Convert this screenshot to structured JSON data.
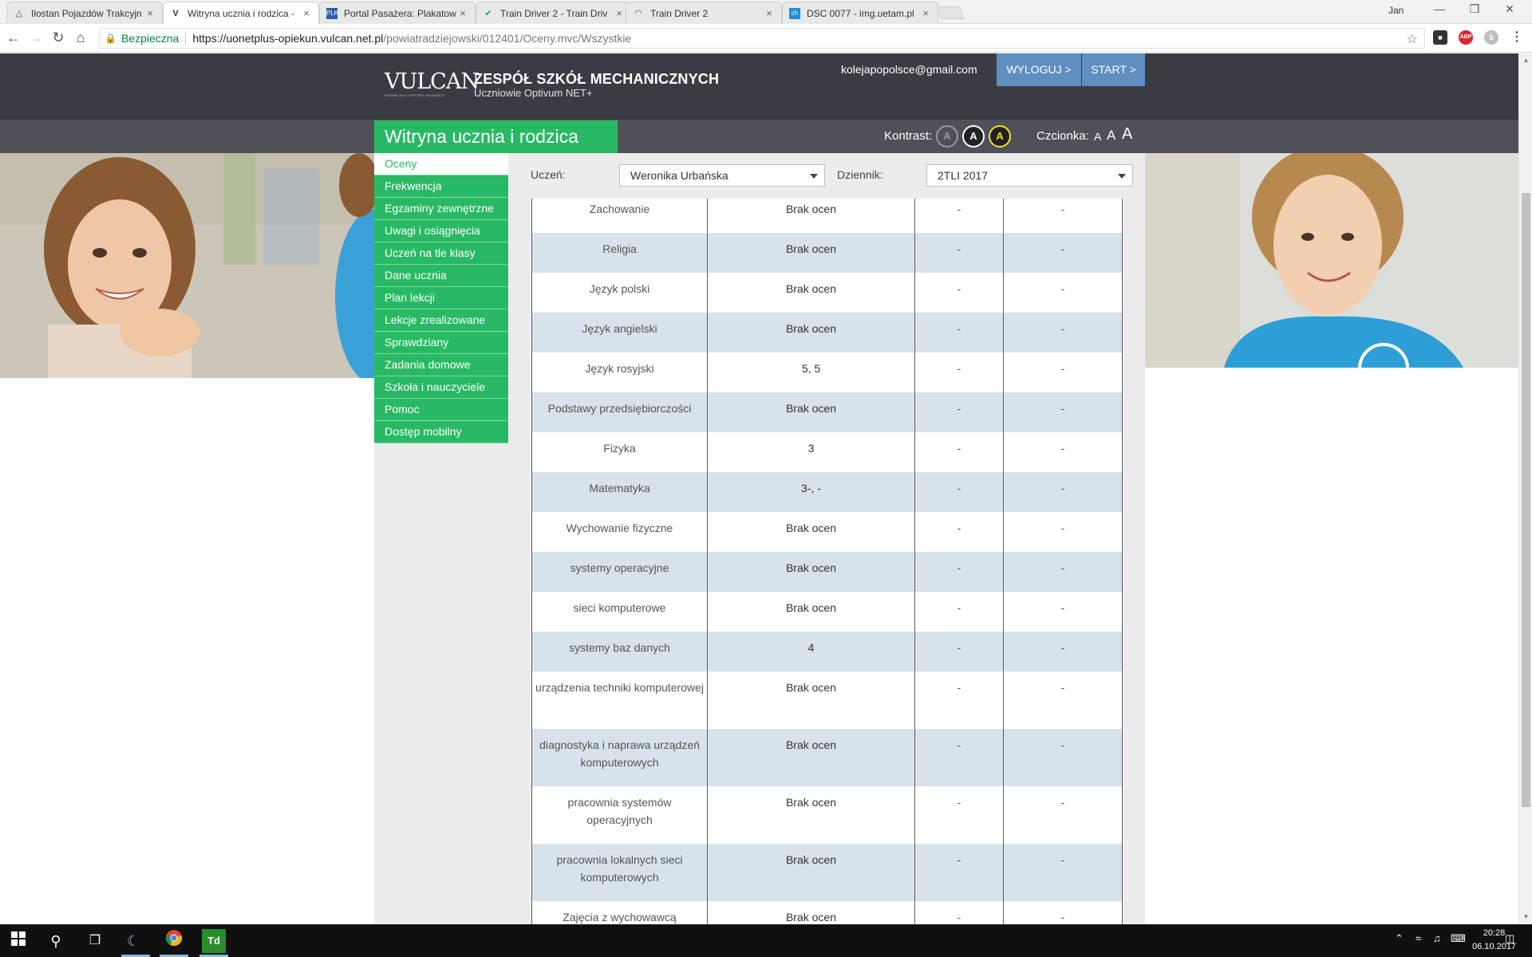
{
  "browser": {
    "tabs": [
      {
        "title": "Ilostan Pojazdów Trakcyjn",
        "icon": "page-icon"
      },
      {
        "title": "Witryna ucznia i rodzica -",
        "icon": "vulcan-icon"
      },
      {
        "title": "Portal Pasażera: Plakatow",
        "icon": "plk-icon"
      },
      {
        "title": "Train Driver 2 - Train Driv",
        "icon": "check-icon"
      },
      {
        "title": "Train Driver 2",
        "icon": "loading-icon"
      },
      {
        "title": "DSC 0077 - img.uetam.pl",
        "icon": "uetam-icon"
      }
    ],
    "profile": "Jan",
    "secure_label": "Bezpieczna",
    "url_host": "https://uonetplus-opiekun.vulcan.net.pl",
    "url_path": "/powiatradziejowski/012401/Oceny.mvc/Wszystkie"
  },
  "header": {
    "logo_text": "VULCAN",
    "logo_tagline": "RAZEM DLA LEPSZEJ EDUKACJI",
    "school_name": "ZESPÓŁ SZKÓŁ MECHANICZNYCH",
    "school_sub": "Uczniowie Optivum NET+",
    "email": "kolejapopolsce@gmail.com",
    "logout": "WYLOGUJ >",
    "start": "START >",
    "site_title": "Witryna ucznia i rodzica",
    "kontrast_label": "Kontrast:",
    "kontrast_buttons": [
      "A",
      "A",
      "A"
    ],
    "czcionka_label": "Czcionka:",
    "font_buttons": [
      "A",
      "A",
      "A"
    ]
  },
  "menu": [
    "Oceny",
    "Frekwencja",
    "Egzaminy zewnętrzne",
    "Uwagi i osiągnięcia",
    "Uczeń na tle klasy",
    "Dane ucznia",
    "Plan lekcji",
    "Lekcje zrealizowane",
    "Sprawdziany",
    "Zadania domowe",
    "Szkoła i nauczyciele",
    "Pomoc",
    "Dostęp mobilny"
  ],
  "filters": {
    "student_label": "Uczeń:",
    "student_value": "Weronika Urbańska",
    "journal_label": "Dziennik:",
    "journal_value": "2TLI 2017"
  },
  "grades": [
    {
      "subject": "Zachowanie",
      "grades": "Brak ocen",
      "avg": "-",
      "final": "-"
    },
    {
      "subject": "Religia",
      "grades": "Brak ocen",
      "avg": "-",
      "final": "-"
    },
    {
      "subject": "Język polski",
      "grades": "Brak ocen",
      "avg": "-",
      "final": "-"
    },
    {
      "subject": "Język angielski",
      "grades": "Brak ocen",
      "avg": "-",
      "final": "-"
    },
    {
      "subject": "Język rosyjski",
      "grades": "5, 5",
      "avg": "-",
      "final": "-"
    },
    {
      "subject": "Podstawy przedsiębiorczości",
      "grades": "Brak ocen",
      "avg": "-",
      "final": "-"
    },
    {
      "subject": "Fizyka",
      "grades": "3",
      "avg": "-",
      "final": "-"
    },
    {
      "subject": "Matematyka",
      "grades": "3-, -",
      "avg": "-",
      "final": "-"
    },
    {
      "subject": "Wychowanie fizyczne",
      "grades": "Brak ocen",
      "avg": "-",
      "final": "-"
    },
    {
      "subject": "systemy operacyjne",
      "grades": "Brak ocen",
      "avg": "-",
      "final": "-"
    },
    {
      "subject": "sieci komputerowe",
      "grades": "Brak ocen",
      "avg": "-",
      "final": "-"
    },
    {
      "subject": "systemy baz danych",
      "grades": "4",
      "avg": "-",
      "final": "-"
    },
    {
      "subject": "urządzenia techniki komputerowej",
      "grades": "Brak ocen",
      "avg": "-",
      "final": "-"
    },
    {
      "subject": "diagnostyka i naprawa urządzeń komputerowych",
      "grades": "Brak ocen",
      "avg": "-",
      "final": "-"
    },
    {
      "subject": "pracownia systemów operacyjnych",
      "grades": "Brak ocen",
      "avg": "-",
      "final": "-"
    },
    {
      "subject": "pracownia lokalnych sieci komputerowych",
      "grades": "Brak ocen",
      "avg": "-",
      "final": "-"
    },
    {
      "subject": "Zajęcia z wychowawcą",
      "grades": "Brak ocen",
      "avg": "-",
      "final": "-"
    }
  ],
  "taskbar": {
    "time": "20:28",
    "date": "06.10.2017"
  },
  "colors": {
    "brand_green": "#29b965",
    "header_dark": "#3b3b44",
    "button_blue": "#5e8fbf",
    "row_alt": "#d8e2ea"
  }
}
